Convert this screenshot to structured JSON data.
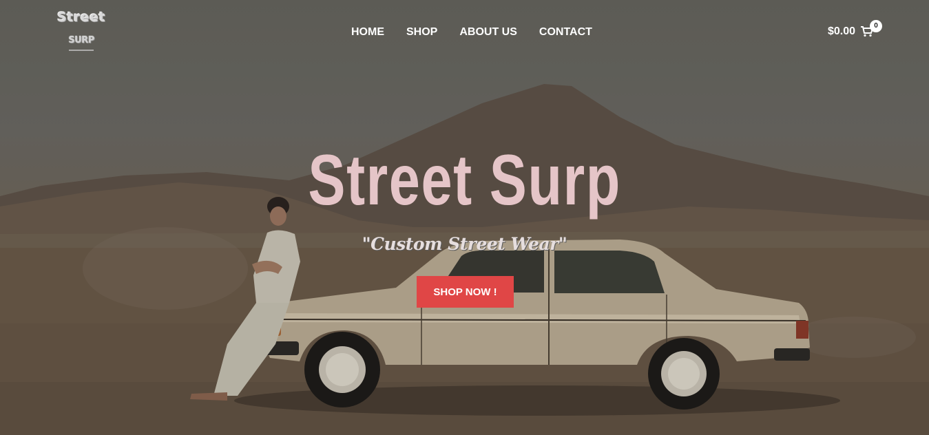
{
  "header": {
    "logo_line1": "Street",
    "logo_line2": "SURP",
    "nav": [
      {
        "label": "HOME"
      },
      {
        "label": "SHOP"
      },
      {
        "label": "ABOUT US"
      },
      {
        "label": "CONTACT"
      }
    ],
    "cart": {
      "total": "$0.00",
      "count": "0",
      "icon": "cart-icon"
    }
  },
  "hero": {
    "title": "Street Surp",
    "subtitle": "\"Custom Street Wear\"",
    "cta_label": "SHOP NOW !"
  },
  "colors": {
    "title": "#e5c5c8",
    "cta_background": "#e04646",
    "nav_text": "#ffffff"
  }
}
